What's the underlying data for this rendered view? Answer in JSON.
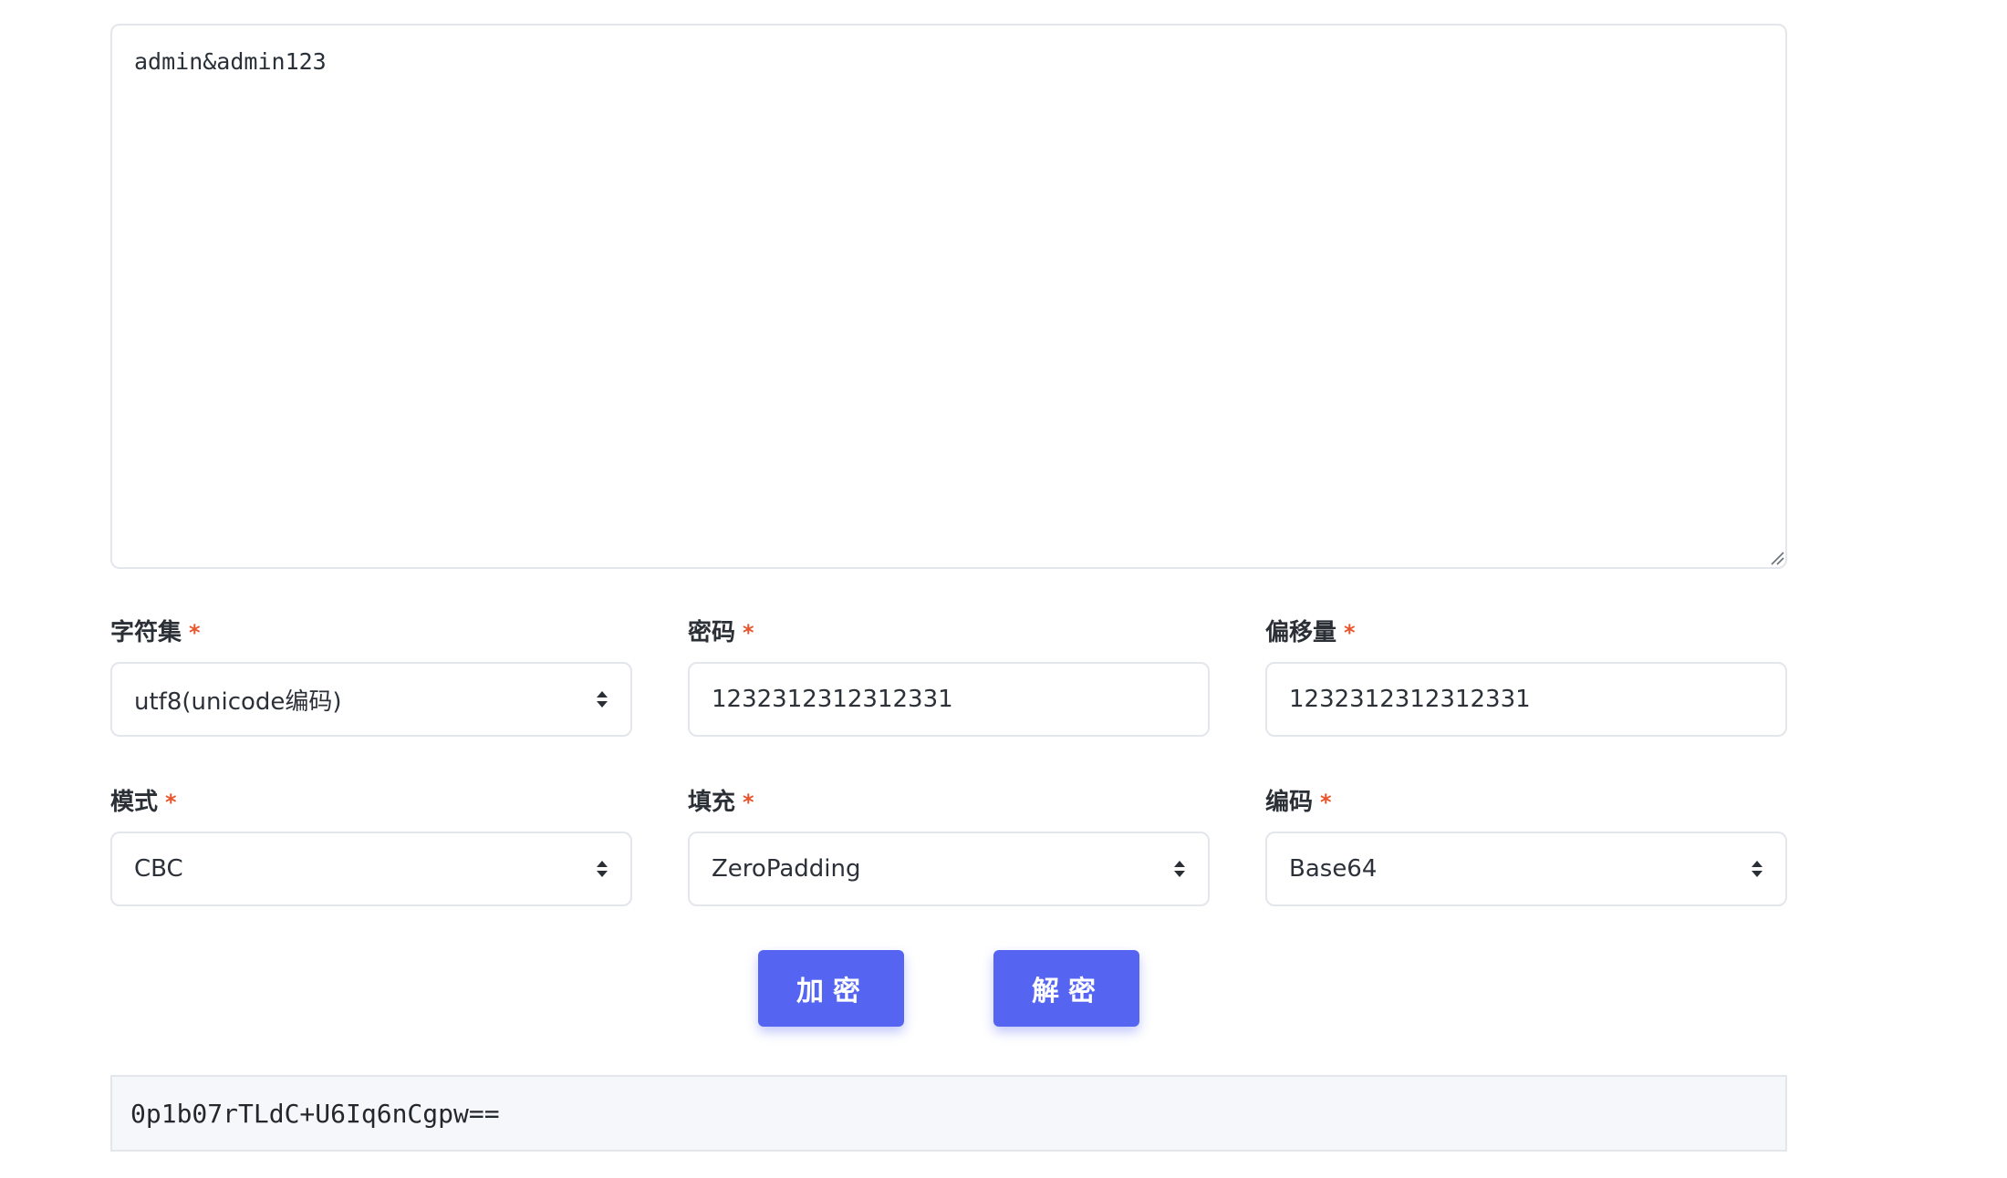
{
  "input": {
    "value": "admin&admin123"
  },
  "fields": {
    "charset": {
      "label": "字符集",
      "required": "*",
      "value": "utf8(unicode编码)"
    },
    "password": {
      "label": "密码",
      "required": "*",
      "value": "1232312312312331"
    },
    "offset": {
      "label": "偏移量",
      "required": "*",
      "value": "1232312312312331"
    },
    "mode": {
      "label": "模式",
      "required": "*",
      "value": "CBC"
    },
    "padding": {
      "label": "填充",
      "required": "*",
      "value": "ZeroPadding"
    },
    "encoding": {
      "label": "编码",
      "required": "*",
      "value": "Base64"
    }
  },
  "buttons": {
    "encrypt": "加密",
    "decrypt": "解密"
  },
  "output": {
    "value": "0p1b07rTLdC+U6Iq6nCgpw=="
  },
  "colors": {
    "accent": "#5565f2",
    "required": "#e8542b"
  },
  "icons": {
    "select": "updown-arrows-icon",
    "grip": "resize-grip-icon"
  }
}
